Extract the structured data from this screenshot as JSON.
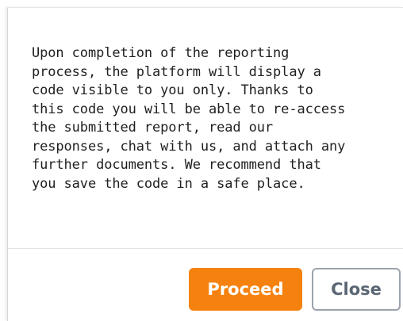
{
  "dialog": {
    "message_lines": [
      "Upon completion of the reporting",
      "process, the platform will display a",
      "code visible to you only. Thanks to",
      "this code you will be able to re-access",
      "the submitted report, read our",
      "responses, chat with us, and attach any",
      "further documents. We recommend that",
      "you save the code in a safe place."
    ],
    "buttons": {
      "proceed_label": "Proceed",
      "close_label": "Close"
    }
  },
  "colors": {
    "primary_button": "#f5820f",
    "secondary_button_border": "#9aa3ad",
    "secondary_button_text": "#5a6673",
    "body_text": "#1f1f1f"
  }
}
